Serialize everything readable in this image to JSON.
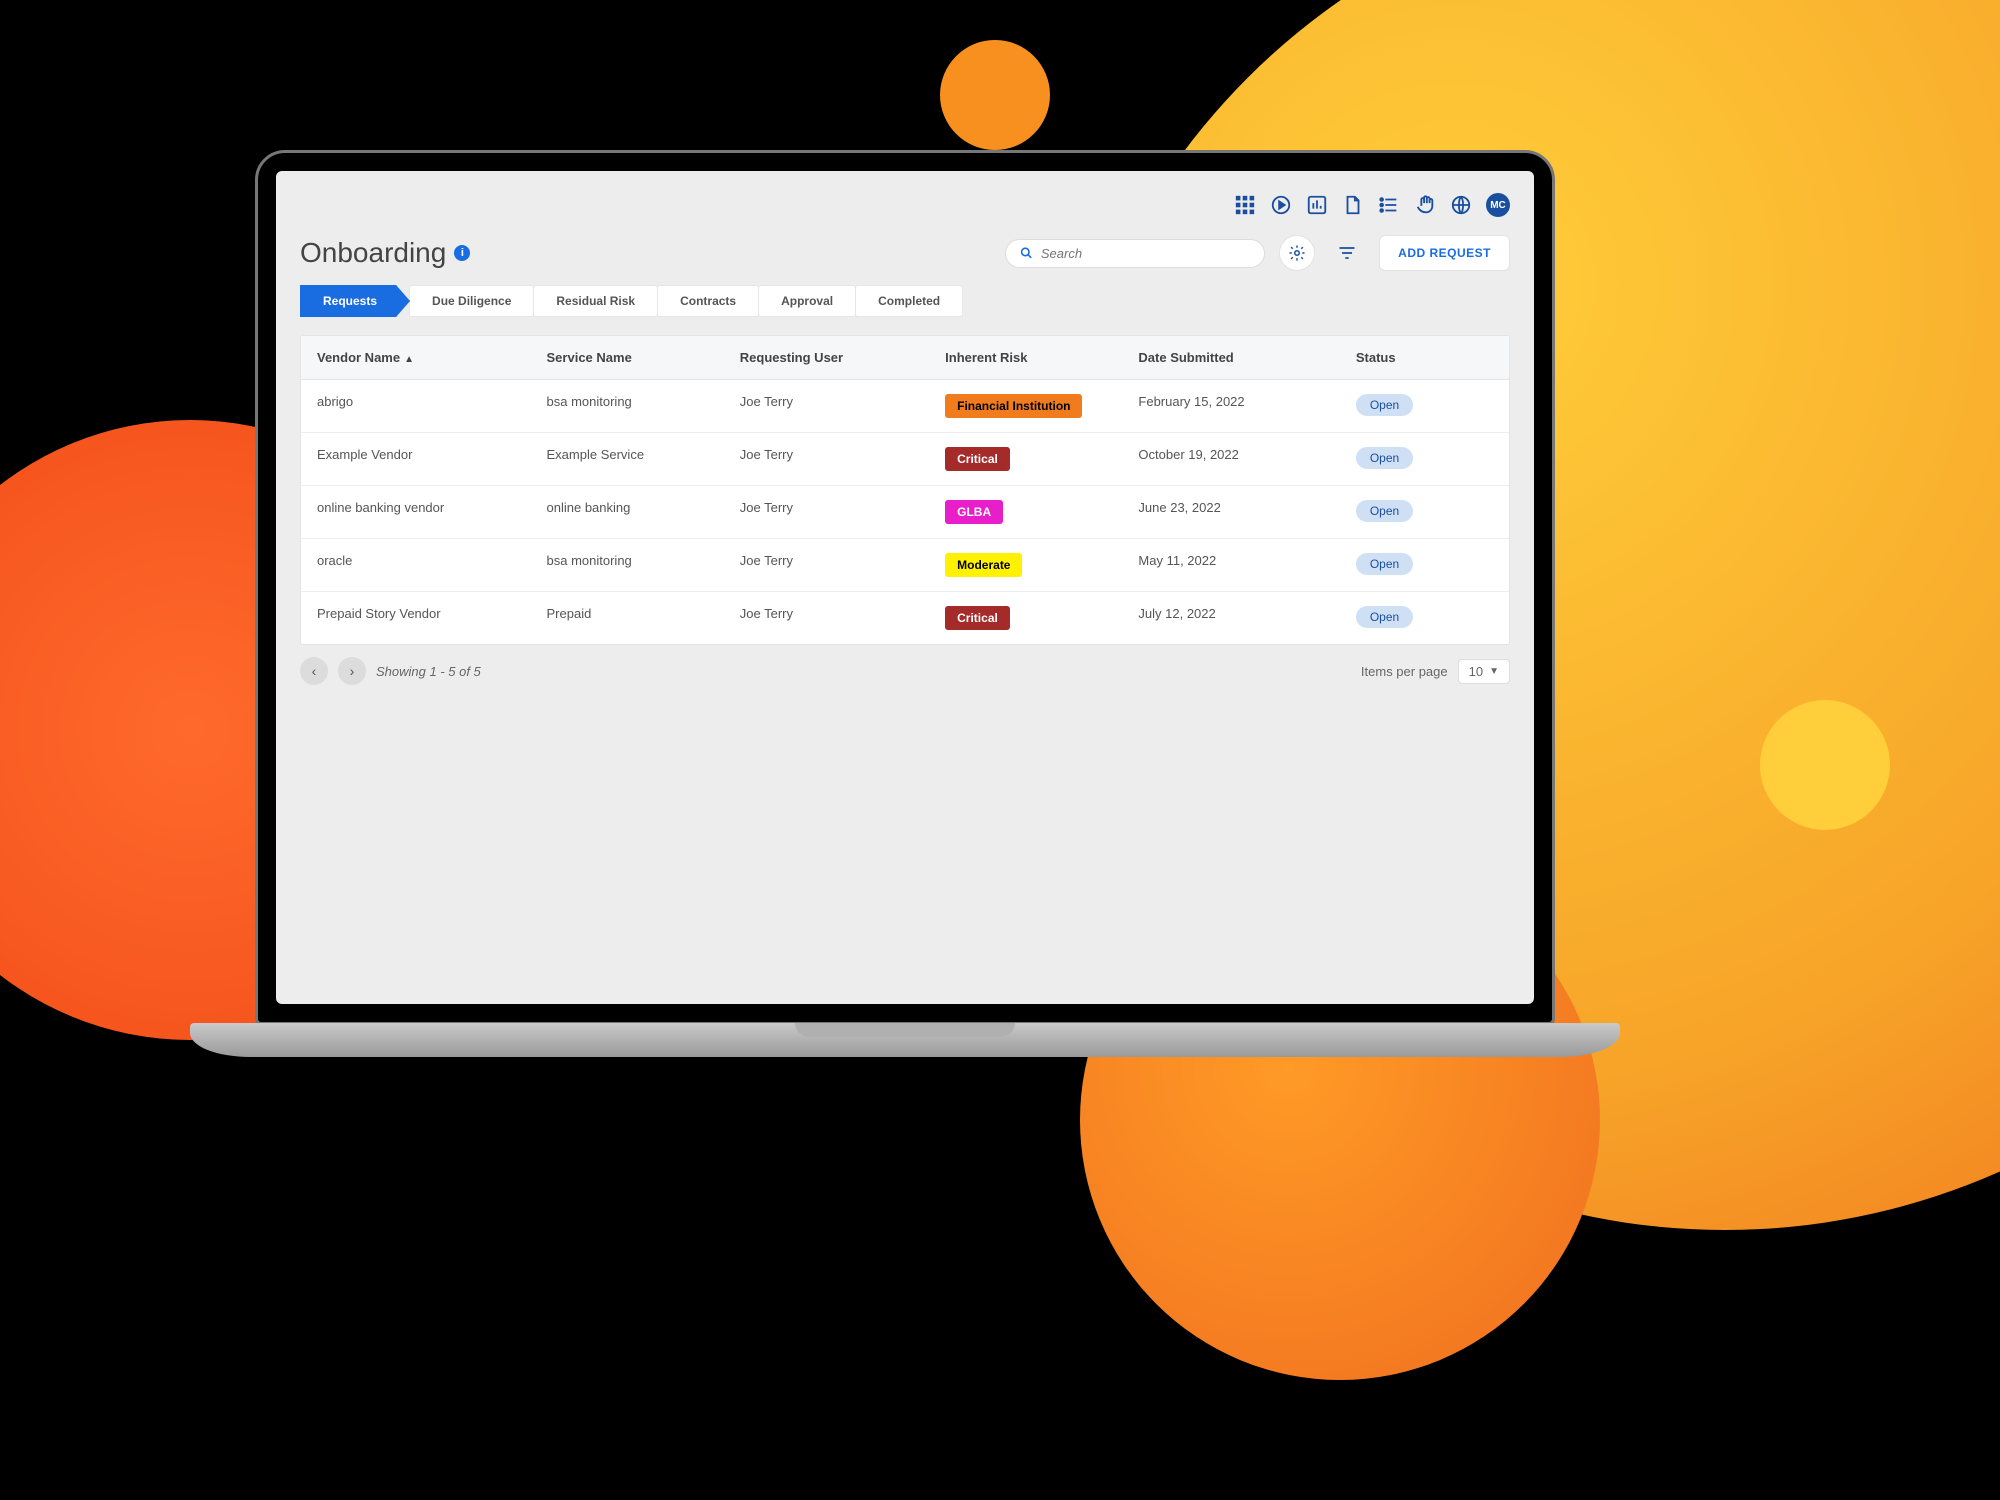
{
  "page": {
    "title": "Onboarding"
  },
  "toolbar": {
    "search_placeholder": "Search",
    "add_request_label": "ADD REQUEST",
    "avatar_initials": "MC"
  },
  "tabs": [
    {
      "label": "Requests",
      "active": true
    },
    {
      "label": "Due Diligence",
      "active": false
    },
    {
      "label": "Residual Risk",
      "active": false
    },
    {
      "label": "Contracts",
      "active": false
    },
    {
      "label": "Approval",
      "active": false
    },
    {
      "label": "Completed",
      "active": false
    }
  ],
  "table": {
    "columns": {
      "vendor": "Vendor Name",
      "service": "Service Name",
      "user": "Requesting User",
      "risk": "Inherent Risk",
      "date": "Date Submitted",
      "status": "Status"
    },
    "sorted_by": "vendor",
    "sort_dir": "asc",
    "rows": [
      {
        "vendor": "abrigo",
        "service": "bsa monitoring",
        "user": "Joe Terry",
        "risk": "Financial Institution",
        "risk_bg": "#f07c1e",
        "risk_fg": "#000",
        "date": "February 15, 2022",
        "status": "Open"
      },
      {
        "vendor": "Example Vendor",
        "service": "Example Service",
        "user": "Joe Terry",
        "risk": "Critical",
        "risk_bg": "#a52a2a",
        "risk_fg": "#fff",
        "date": "October 19, 2022",
        "status": "Open"
      },
      {
        "vendor": "online banking vendor",
        "service": "online banking",
        "user": "Joe Terry",
        "risk": "GLBA",
        "risk_bg": "#e91ecb",
        "risk_fg": "#fff",
        "date": "June 23, 2022",
        "status": "Open"
      },
      {
        "vendor": "oracle",
        "service": "bsa monitoring",
        "user": "Joe Terry",
        "risk": "Moderate",
        "risk_bg": "#fff200",
        "risk_fg": "#000",
        "date": "May 11, 2022",
        "status": "Open"
      },
      {
        "vendor": "Prepaid Story Vendor",
        "service": "Prepaid",
        "user": "Joe Terry",
        "risk": "Critical",
        "risk_bg": "#a52a2a",
        "risk_fg": "#fff",
        "date": "July 12, 2022",
        "status": "Open"
      }
    ]
  },
  "pager": {
    "showing": "Showing 1 - 5 of 5",
    "items_per_page_label": "Items per page",
    "items_per_page_value": "10"
  },
  "colors": {
    "primary": "#1a6de0"
  }
}
